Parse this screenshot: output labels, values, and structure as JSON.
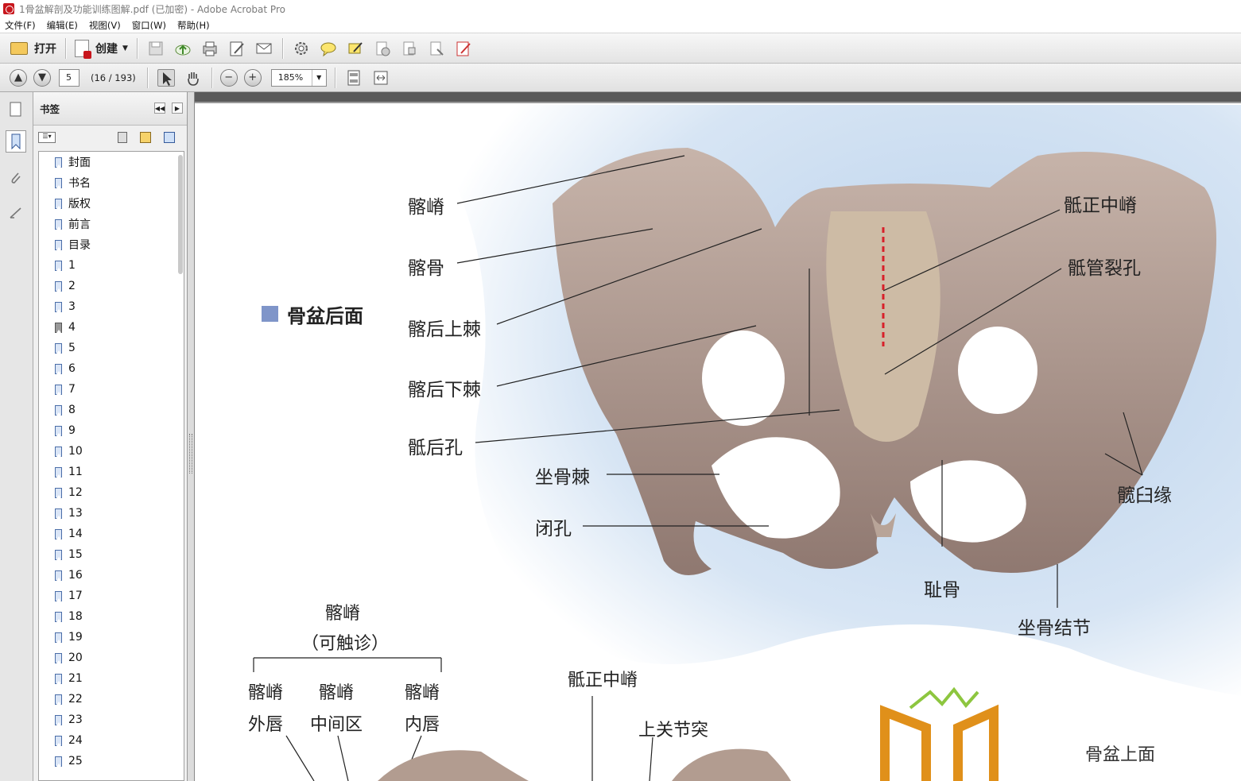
{
  "window": {
    "title": "1骨盆解剖及功能训练图解.pdf  (已加密)   - Adobe Acrobat Pro"
  },
  "menu": [
    "文件(F)",
    "编辑(E)",
    "视图(V)",
    "窗口(W)",
    "帮助(H)"
  ],
  "toolbar": {
    "open_label": "打开",
    "create_label": "创建"
  },
  "nav": {
    "page_input": "5",
    "page_count": "(16 / 193)",
    "zoom": "185%"
  },
  "panel": {
    "title": "书签",
    "bookmarks": [
      "封面",
      "书名",
      "版权",
      "前言",
      "目录",
      "1",
      "2",
      "3",
      "4",
      "5",
      "6",
      "7",
      "8",
      "9",
      "10",
      "11",
      "12",
      "13",
      "14",
      "15",
      "16",
      "17",
      "18",
      "19",
      "20",
      "21",
      "22",
      "23",
      "24",
      "25"
    ]
  },
  "figure": {
    "title": "骨盆后面",
    "labels_left": [
      "髂嵴",
      "髂骨",
      "髂后上棘",
      "髂后下棘",
      "骶后孔",
      "坐骨棘",
      "闭孔"
    ],
    "labels_right": [
      "骶正中嵴",
      "骶管裂孔",
      "髋臼缘",
      "耻骨",
      "坐骨结节"
    ],
    "lower_labels": {
      "group_title": "髂嵴",
      "group_sub": "（可触诊）",
      "cols": [
        [
          "髂嵴",
          "外唇"
        ],
        [
          "髂嵴",
          "中间区"
        ],
        [
          "髂嵴",
          "内唇"
        ]
      ],
      "mid": "骶正中嵴",
      "right": "上关节突"
    },
    "watermark": {
      "text": "骨盆上面"
    }
  },
  "colors": {
    "accent_square": "#7f95c9",
    "bone": "#b9a59a",
    "sky": "#c9dbee"
  }
}
